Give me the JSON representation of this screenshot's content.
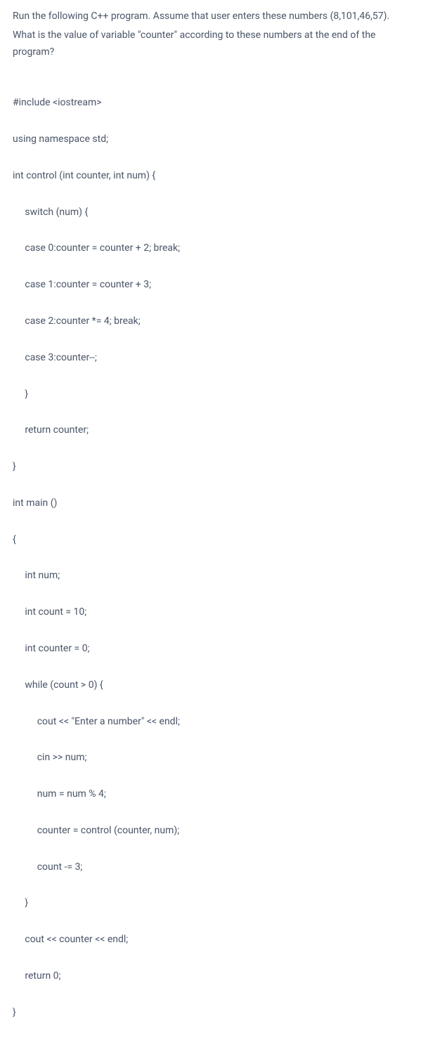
{
  "question": {
    "line1": "Run the following C++ program. Assume that user enters these numbers (8,101,46,57).",
    "line2": "What is the value of variable \"counter\" according to these numbers at the end of the program?"
  },
  "code": {
    "l01": "#include <iostream>",
    "l02": "using namespace std;",
    "l03": "int control (int counter, int num) {",
    "l04": "     switch (num) {",
    "l05": "     case 0:counter = counter + 2; break;",
    "l06": "     case 1:counter = counter + 3;",
    "l07": "     case 2:counter *= 4; break;",
    "l08": "     case 3:counter--;",
    "l09": "     }",
    "l10": "     return counter;",
    "l11": "}",
    "l12": "int main ()",
    "l13": "{",
    "l14": "     int num;",
    "l15": "     int count = 10;",
    "l16": "     int counter = 0;",
    "l17": "     while (count > 0) {",
    "l18": "          cout << \"Enter a number\" << endl;",
    "l19": "          cin >> num;",
    "l20": "          num = num % 4;",
    "l21": "          counter = control (counter, num);",
    "l22": "          count -= 3;",
    "l23": "     }",
    "l24": "     cout << counter << endl;",
    "l25": "     return 0;",
    "l26": "}"
  }
}
